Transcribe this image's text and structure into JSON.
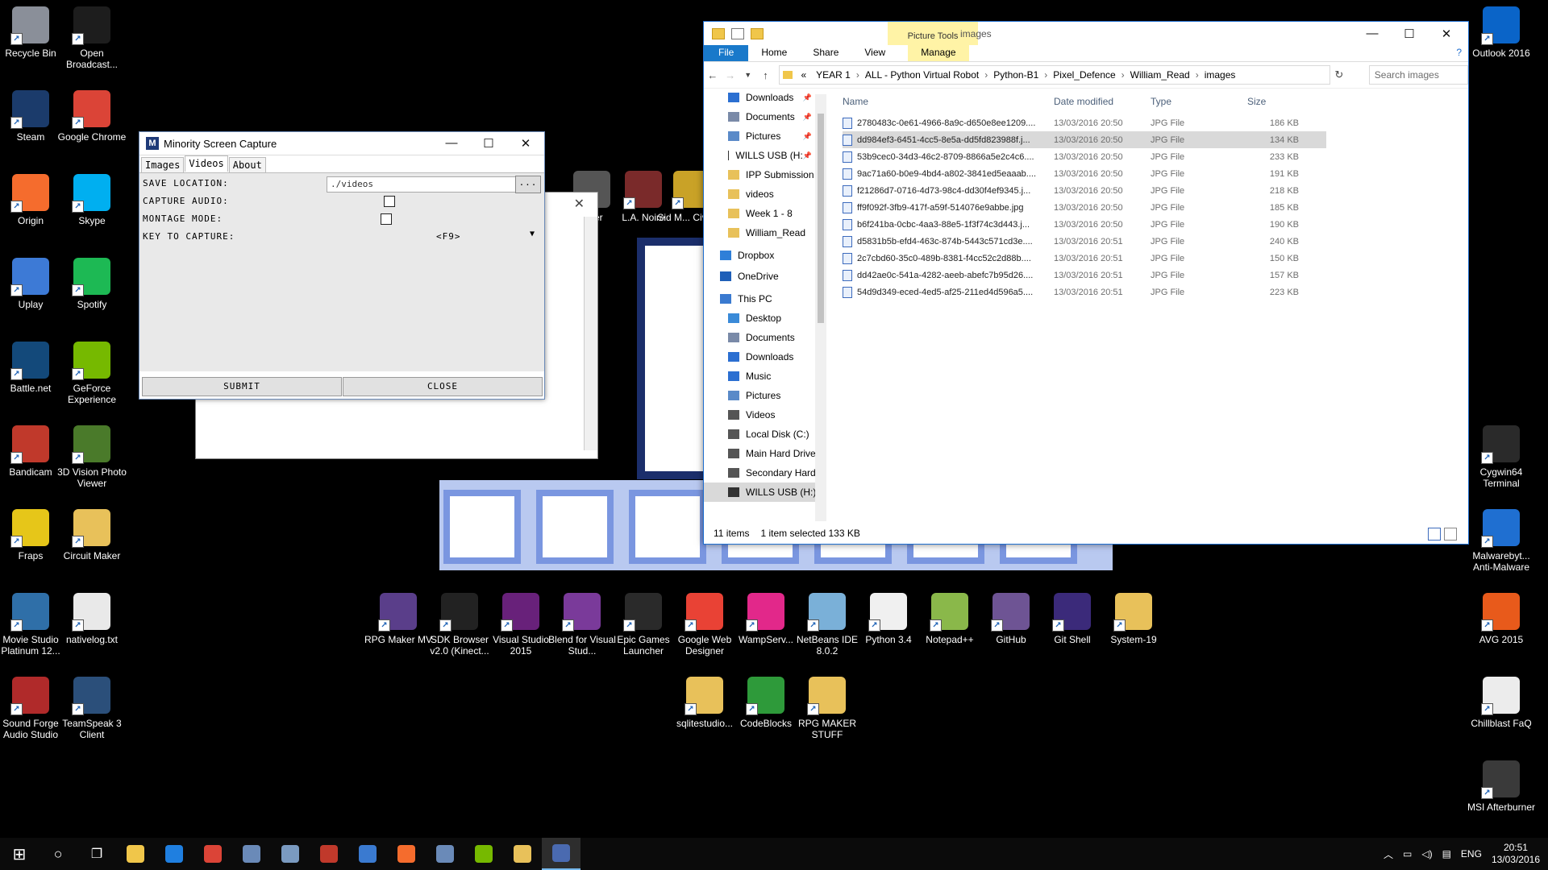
{
  "desktop": {
    "icons_left": [
      {
        "label": "Recycle Bin",
        "icon": "recycle-bin-icon",
        "color": "#8a8f99"
      },
      {
        "label": "Open Broadcast...",
        "icon": "obs-icon",
        "color": "#1d1d1d"
      },
      {
        "label": "Steam",
        "icon": "steam-icon",
        "color": "#1b3b6b"
      },
      {
        "label": "Google Chrome",
        "icon": "chrome-icon",
        "color": "#db4437"
      },
      {
        "label": "Origin",
        "icon": "origin-icon",
        "color": "#f56c2d"
      },
      {
        "label": "Skype",
        "icon": "skype-icon",
        "color": "#00aff0"
      },
      {
        "label": "Uplay",
        "icon": "uplay-icon",
        "color": "#3d7ad6"
      },
      {
        "label": "Spotify",
        "icon": "spotify-icon",
        "color": "#1db954"
      },
      {
        "label": "Battle.net",
        "icon": "battlenet-icon",
        "color": "#13497a"
      },
      {
        "label": "GeForce Experience",
        "icon": "geforce-icon",
        "color": "#76b900"
      },
      {
        "label": "Bandicam",
        "icon": "bandicam-icon",
        "color": "#c0392b"
      },
      {
        "label": "3D Vision Photo Viewer",
        "icon": "3dvision-icon",
        "color": "#4a7a2a"
      },
      {
        "label": "Fraps",
        "icon": "fraps-icon",
        "color": "#e6c619"
      },
      {
        "label": "Circuit Maker",
        "icon": "folder-icon",
        "color": "#e8c15a"
      },
      {
        "label": "Movie Studio Platinum 12...",
        "icon": "movie-studio-icon",
        "color": "#2f6fa8"
      },
      {
        "label": "nativelog.txt",
        "icon": "text-file-icon",
        "color": "#e9e9e9"
      },
      {
        "label": "Sound Forge Audio Studio",
        "icon": "sound-forge-icon",
        "color": "#b02a2a"
      },
      {
        "label": "TeamSpeak 3 Client",
        "icon": "teamspeak-icon",
        "color": "#2b4f7a"
      }
    ],
    "icons_right": [
      {
        "label": "Outlook 2016",
        "icon": "outlook-icon",
        "color": "#0a64c8"
      },
      {
        "label": "Cygwin64 Terminal",
        "icon": "cygwin-icon",
        "color": "#2a2a2a"
      },
      {
        "label": "Malwarebyt... Anti-Malware",
        "icon": "malwarebytes-icon",
        "color": "#1f6fd1"
      },
      {
        "label": "AVG 2015",
        "icon": "avg-icon",
        "color": "#e85a1b"
      },
      {
        "label": "Chillblast FaQ",
        "icon": "chillblast-icon",
        "color": "#ececec"
      },
      {
        "label": "MSI Afterburner",
        "icon": "msi-afterburner-icon",
        "color": "#3a3a3a"
      }
    ],
    "icons_middle": [
      {
        "label": "L.A. Noire",
        "icon": "la-noire-icon",
        "color": "#7a2a2a"
      },
      {
        "label": "Sid M... Civiliz...",
        "icon": "civilization-icon",
        "color": "#c9a227"
      },
      {
        "label": "...der",
        "icon": "game-icon",
        "color": "#555555"
      }
    ],
    "icons_bottom_row1": [
      {
        "label": "RPG Maker MV",
        "icon": "rpg-maker-icon",
        "color": "#5a3e8a"
      },
      {
        "label": "SDK Browser v2.0 (Kinect...",
        "icon": "kinect-icon",
        "color": "#222222"
      },
      {
        "label": "Visual Studio 2015",
        "icon": "visual-studio-icon",
        "color": "#68217a"
      },
      {
        "label": "Blend for Visual Stud...",
        "icon": "blend-icon",
        "color": "#7a3a9a"
      },
      {
        "label": "Epic Games Launcher",
        "icon": "epic-games-icon",
        "color": "#2a2a2a"
      },
      {
        "label": "Google Web Designer",
        "icon": "web-designer-icon",
        "color": "#e94235"
      },
      {
        "label": "WampServ...",
        "icon": "wamp-icon",
        "color": "#e2288a"
      },
      {
        "label": "NetBeans IDE 8.0.2",
        "icon": "netbeans-icon",
        "color": "#7ab0d8"
      },
      {
        "label": "Python 3.4",
        "icon": "python-icon",
        "color": "#f0f0f0"
      },
      {
        "label": "Notepad++",
        "icon": "notepad-plus-icon",
        "color": "#8ab84a"
      },
      {
        "label": "GitHub",
        "icon": "github-icon",
        "color": "#6e5494"
      },
      {
        "label": "Git Shell",
        "icon": "git-shell-icon",
        "color": "#3b2a7a"
      },
      {
        "label": "System-19",
        "icon": "folder-icon",
        "color": "#e8c15a"
      }
    ],
    "icons_bottom_row2": [
      {
        "label": "sqlitestudio...",
        "icon": "folder-icon",
        "color": "#e8c15a"
      },
      {
        "label": "CodeBlocks",
        "icon": "codeblocks-icon",
        "color": "#2e9a3a"
      },
      {
        "label": "RPG MAKER STUFF",
        "icon": "folder-icon",
        "color": "#e8c15a"
      }
    ]
  },
  "msc": {
    "title": "Minority Screen Capture",
    "tabs": [
      "Images",
      "Videos",
      "About"
    ],
    "save_location_label": "SAVE LOCATION:",
    "save_location_value": "./videos",
    "browse_label": "...",
    "capture_audio_label": "CAPTURE AUDIO:",
    "montage_mode_label": "MONTAGE MODE:",
    "key_label": "KEY TO CAPTURE:",
    "key_value": "<F9>",
    "submit": "SUBMIT",
    "close": "CLOSE"
  },
  "explorer": {
    "picture_tools": "Picture Tools",
    "window_title": "images",
    "ribbon": [
      "File",
      "Home",
      "Share",
      "View",
      "Manage"
    ],
    "path": [
      "«",
      "YEAR 1",
      "ALL - Python Virtual Robot",
      "Python-B1",
      "Pixel_Defence",
      "William_Read",
      "images"
    ],
    "search_placeholder": "Search images",
    "nav_items": [
      {
        "label": "Downloads",
        "icon": "downloads-icon",
        "color": "#2b6fd1",
        "pinned": true
      },
      {
        "label": "Documents",
        "icon": "documents-icon",
        "color": "#7a8aa8",
        "pinned": true
      },
      {
        "label": "Pictures",
        "icon": "pictures-icon",
        "color": "#5a8ac8",
        "pinned": true
      },
      {
        "label": "WILLS USB (H:",
        "icon": "usb-drive-icon",
        "color": "#333333",
        "pinned": true
      },
      {
        "label": "IPP Submission",
        "icon": "folder-icon",
        "color": "#e8c15a",
        "pinned": false
      },
      {
        "label": "videos",
        "icon": "folder-icon",
        "color": "#e8c15a",
        "pinned": false
      },
      {
        "label": "Week 1 - 8",
        "icon": "folder-icon",
        "color": "#e8c15a",
        "pinned": false
      },
      {
        "label": "William_Read",
        "icon": "folder-icon",
        "color": "#e8c15a",
        "pinned": false
      },
      {
        "label": "Dropbox",
        "icon": "dropbox-icon",
        "color": "#2f7fd8",
        "pinned": false
      },
      {
        "label": "OneDrive",
        "icon": "onedrive-icon",
        "color": "#1f5fb8",
        "pinned": false
      },
      {
        "label": "This PC",
        "icon": "this-pc-icon",
        "color": "#3a7ad0",
        "pinned": false
      },
      {
        "label": "Desktop",
        "icon": "desktop-icon",
        "color": "#3a8ad8",
        "pinned": false
      },
      {
        "label": "Documents",
        "icon": "documents-icon",
        "color": "#7a8aa8",
        "pinned": false
      },
      {
        "label": "Downloads",
        "icon": "downloads-icon",
        "color": "#2b6fd1",
        "pinned": false
      },
      {
        "label": "Music",
        "icon": "music-icon",
        "color": "#2b6fd1",
        "pinned": false
      },
      {
        "label": "Pictures",
        "icon": "pictures-icon",
        "color": "#5a8ac8",
        "pinned": false
      },
      {
        "label": "Videos",
        "icon": "videos-icon",
        "color": "#555555",
        "pinned": false
      },
      {
        "label": "Local Disk (C:)",
        "icon": "disk-icon",
        "color": "#555555",
        "pinned": false
      },
      {
        "label": "Main Hard Drive",
        "icon": "disk-icon",
        "color": "#555555",
        "pinned": false
      },
      {
        "label": "Secondary Hard",
        "icon": "disk-icon",
        "color": "#555555",
        "pinned": false
      },
      {
        "label": "WILLS USB (H:)",
        "icon": "usb-drive-icon",
        "color": "#333333",
        "pinned": false
      }
    ],
    "columns": [
      "Name",
      "Date modified",
      "Type",
      "Size"
    ],
    "files": [
      {
        "name": "2780483c-0e61-4966-8a9c-d650e8ee1209....",
        "date": "13/03/2016 20:50",
        "type": "JPG File",
        "size": "186 KB"
      },
      {
        "name": "dd984ef3-6451-4cc5-8e5a-dd5fd823988f.j...",
        "date": "13/03/2016 20:50",
        "type": "JPG File",
        "size": "134 KB",
        "selected": true
      },
      {
        "name": "53b9cec0-34d3-46c2-8709-8866a5e2c4c6....",
        "date": "13/03/2016 20:50",
        "type": "JPG File",
        "size": "233 KB"
      },
      {
        "name": "9ac71a60-b0e9-4bd4-a802-3841ed5eaaab....",
        "date": "13/03/2016 20:50",
        "type": "JPG File",
        "size": "191 KB"
      },
      {
        "name": "f21286d7-0716-4d73-98c4-dd30f4ef9345.j...",
        "date": "13/03/2016 20:50",
        "type": "JPG File",
        "size": "218 KB"
      },
      {
        "name": "ff9f092f-3fb9-417f-a59f-514076e9abbe.jpg",
        "date": "13/03/2016 20:50",
        "type": "JPG File",
        "size": "185 KB"
      },
      {
        "name": "b6f241ba-0cbc-4aa3-88e5-1f3f74c3d443.j...",
        "date": "13/03/2016 20:50",
        "type": "JPG File",
        "size": "190 KB"
      },
      {
        "name": "d5831b5b-efd4-463c-874b-5443c571cd3e....",
        "date": "13/03/2016 20:51",
        "type": "JPG File",
        "size": "240 KB"
      },
      {
        "name": "2c7cbd60-35c0-489b-8381-f4cc52c2d88b....",
        "date": "13/03/2016 20:51",
        "type": "JPG File",
        "size": "150 KB"
      },
      {
        "name": "dd42ae0c-541a-4282-aeeb-abefc7b95d26....",
        "date": "13/03/2016 20:51",
        "type": "JPG File",
        "size": "157 KB"
      },
      {
        "name": "54d9d349-eced-4ed5-af25-211ed4d596a5....",
        "date": "13/03/2016 20:51",
        "type": "JPG File",
        "size": "223 KB"
      }
    ],
    "status_items": "11 items",
    "status_selected": "1 item selected  133 KB"
  },
  "taskbar": {
    "items": [
      {
        "icon": "start-icon",
        "color": "#ffffff"
      },
      {
        "icon": "cortana-icon",
        "color": "#ffffff"
      },
      {
        "icon": "task-view-icon",
        "color": "#ffffff"
      },
      {
        "icon": "file-explorer-icon",
        "color": "#f0c64a"
      },
      {
        "icon": "edge-icon",
        "color": "#1f7fe0"
      },
      {
        "icon": "chrome-icon",
        "color": "#db4437"
      },
      {
        "icon": "steam-icon",
        "color": "#6a8ab8"
      },
      {
        "icon": "steam-app-icon",
        "color": "#7a9ac0"
      },
      {
        "icon": "bandicam-icon",
        "color": "#c0392b"
      },
      {
        "icon": "fraps-icon",
        "color": "#3a7ad0"
      },
      {
        "icon": "origin-icon",
        "color": "#f56c2d"
      },
      {
        "icon": "teamspeak-icon",
        "color": "#6a8ab8"
      },
      {
        "icon": "nvidia-icon",
        "color": "#76b900"
      },
      {
        "icon": "python-icon",
        "color": "#e8c15a"
      },
      {
        "icon": "minority-capture-icon",
        "color": "#4a6ab0",
        "active": true
      }
    ],
    "lang": "ENG",
    "time": "20:51",
    "date": "13/03/2016"
  }
}
